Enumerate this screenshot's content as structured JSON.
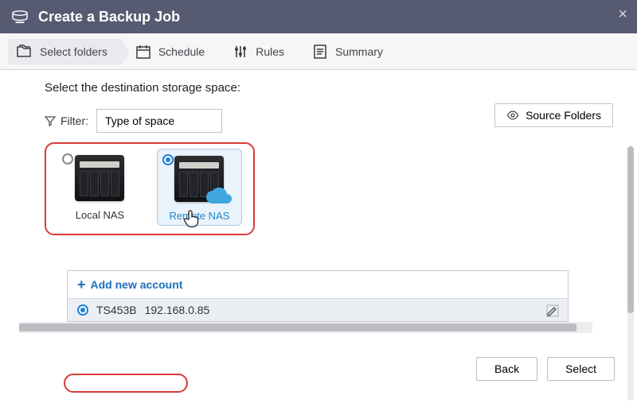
{
  "title": "Create a Backup Job",
  "steps": {
    "select_folders": "Select folders",
    "schedule": "Schedule",
    "rules": "Rules",
    "summary": "Summary"
  },
  "section_heading": "Select the destination storage space:",
  "filter": {
    "label": "Filter:",
    "value": "Type of space"
  },
  "source_folders_btn": "Source Folders",
  "destinations": {
    "local": "Local NAS",
    "remote": "Remote NAS"
  },
  "accounts": {
    "add_label": "Add new account",
    "item": {
      "name": "TS453B",
      "ip": "192.168.0.85"
    }
  },
  "footer": {
    "back": "Back",
    "select": "Select"
  }
}
